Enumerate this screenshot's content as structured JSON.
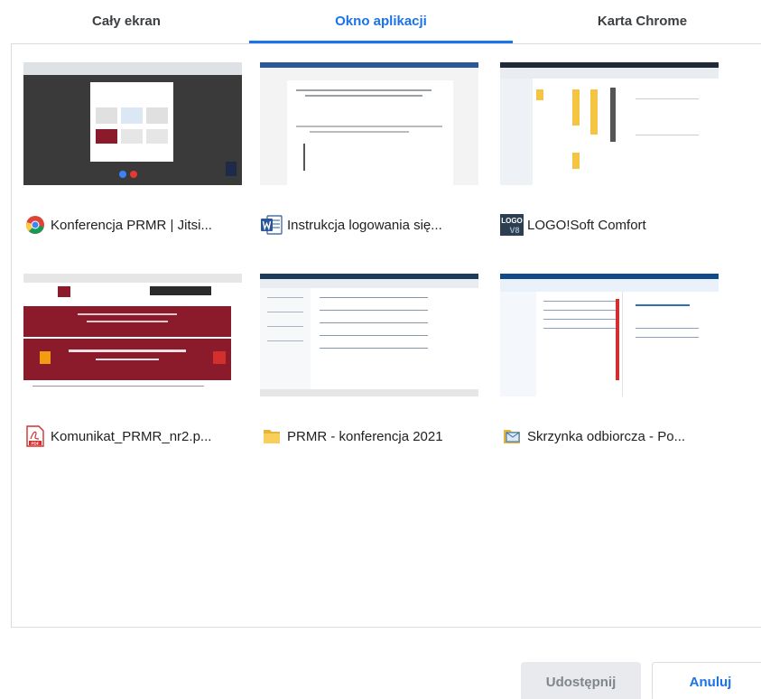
{
  "tabs": [
    {
      "label": "Cały ekran"
    },
    {
      "label": "Okno aplikacji"
    },
    {
      "label": "Karta Chrome"
    }
  ],
  "windows": [
    {
      "title": "Konferencja PRMR | Jitsi...",
      "icon": "chrome-icon"
    },
    {
      "title": "Instrukcja logowania się...",
      "icon": "word-icon"
    },
    {
      "title": "LOGO!Soft Comfort",
      "icon": "logo-soft-icon",
      "icon_text_top": "LOGO",
      "icon_text_bottom": "V8"
    },
    {
      "title": "Komunikat_PRMR_nr2.p...",
      "icon": "pdf-icon",
      "icon_text": "PDF"
    },
    {
      "title": "PRMR - konferencja 2021",
      "icon": "folder-icon"
    },
    {
      "title": "Skrzynka odbiorcza - Po...",
      "icon": "outlook-mailbox-icon"
    }
  ],
  "buttons": {
    "share_label": "Udostępnij",
    "cancel_label": "Anuluj"
  },
  "colors": {
    "accent": "#1a73e8",
    "disabled_button_bg": "#e8eaed",
    "pdf_banner": "#8b1a2b"
  }
}
